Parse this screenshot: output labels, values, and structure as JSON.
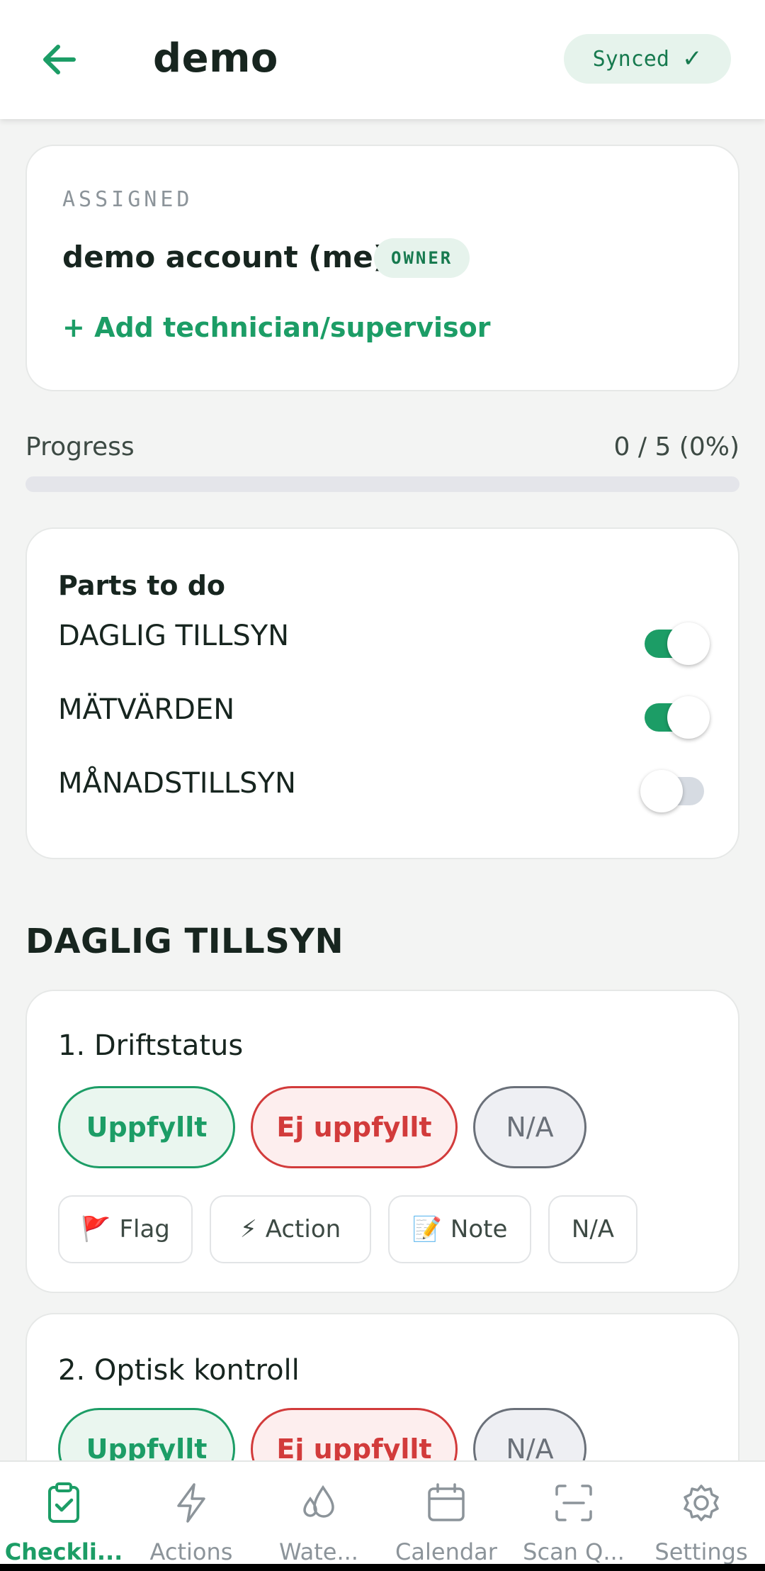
{
  "header": {
    "title": "demo",
    "sync_status": "Synced",
    "sync_check": "✓",
    "back_icon": "arrow-left-icon",
    "accent_color": "#1c9d66"
  },
  "assigned": {
    "label": "ASSIGNED",
    "name": "demo account (me)",
    "role_badge": "OWNER",
    "add_link": "+ Add technician/supervisor"
  },
  "progress": {
    "label": "Progress",
    "value_text": "0 / 5 (0%)",
    "fraction": 0
  },
  "parts": {
    "title": "Parts to do",
    "items": [
      {
        "label": "DAGLIG TILLSYN",
        "enabled": true
      },
      {
        "label": "MÄTVÄRDEN",
        "enabled": true
      },
      {
        "label": "MÅNADSTILLSYN",
        "enabled": false
      }
    ]
  },
  "section": {
    "title": "DAGLIG TILLSYN",
    "items": [
      {
        "title": "1. Driftstatus",
        "status_buttons": {
          "ok": "Uppfyllt",
          "fail": "Ej uppfyllt",
          "na": "N/A"
        },
        "chips": {
          "flag": "Flag",
          "flag_emoji": "🚩",
          "action": "Action",
          "action_emoji": "⚡",
          "note": "Note",
          "note_emoji": "📝",
          "na": "N/A"
        }
      },
      {
        "title": "2. Optisk kontroll",
        "status_buttons": {
          "ok": "Uppfyllt",
          "fail": "Ej uppfyllt",
          "na": "N/A"
        }
      }
    ]
  },
  "nav": {
    "items": [
      {
        "label": "Checkli...",
        "icon": "clipboard-check-icon",
        "active": true
      },
      {
        "label": "Actions",
        "icon": "lightning-icon",
        "active": false
      },
      {
        "label": "Wate...",
        "icon": "water-drops-icon",
        "active": false
      },
      {
        "label": "Calendar",
        "icon": "calendar-icon",
        "active": false
      },
      {
        "label": "Scan Q...",
        "icon": "scan-qr-icon",
        "active": false
      },
      {
        "label": "Settings",
        "icon": "gear-icon",
        "active": false
      }
    ]
  }
}
